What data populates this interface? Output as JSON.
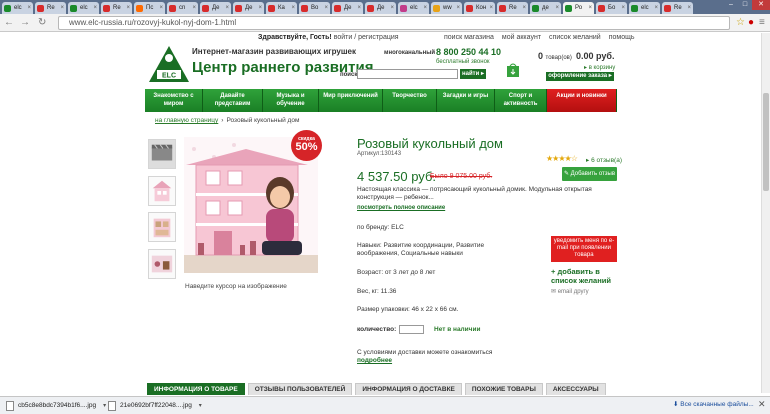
{
  "browser": {
    "tabs": [
      {
        "title": "elc",
        "color": "#1a8a2a"
      },
      {
        "title": "Re",
        "color": "#d72b2b"
      },
      {
        "title": "elc",
        "color": "#1a8a2a"
      },
      {
        "title": "Re",
        "color": "#d72b2b"
      },
      {
        "title": "Пс",
        "color": "#ff6a00"
      },
      {
        "title": "cn",
        "color": "#d72b2b"
      },
      {
        "title": "Де",
        "color": "#d72b2b"
      },
      {
        "title": "Де",
        "color": "#d72b2b"
      },
      {
        "title": "Ка",
        "color": "#d72b2b"
      },
      {
        "title": "Bo",
        "color": "#d72b2b"
      },
      {
        "title": "Де",
        "color": "#d72b2b"
      },
      {
        "title": "Де",
        "color": "#d72b2b"
      },
      {
        "title": "elc",
        "color": "#c23b8a"
      },
      {
        "title": "ww",
        "color": "#e8a317"
      },
      {
        "title": "Кон",
        "color": "#d72b2b"
      },
      {
        "title": "Re",
        "color": "#d72b2b"
      },
      {
        "title": "де",
        "color": "#1a8a2a"
      },
      {
        "title": "Ро",
        "color": "#1a8a2a",
        "active": true
      },
      {
        "title": "Бо",
        "color": "#d72b2b"
      },
      {
        "title": "elc",
        "color": "#1a8a2a"
      },
      {
        "title": "Re",
        "color": "#d72b2b"
      }
    ],
    "url": "www.elc-russia.ru/rozovyj-kukol-nyj-dom-1.html"
  },
  "header": {
    "greeting": "Здравствуйте, Гость!",
    "login": "войти / регистрация",
    "links": [
      "поиск магазина",
      "мой аккаунт",
      "список желаний",
      "помощь"
    ],
    "tagline": "Интернет-магазин развивающих игрушек",
    "brand": "Центр раннего развития",
    "logo_text": "ELC",
    "phone_label": "многоканальный",
    "phone": "8 800 250 44 10",
    "free_call": "бесплатный звонок",
    "search_label": "поиск",
    "search_button": "найти",
    "cart": {
      "count": "0",
      "count_unit": "товар(ов)",
      "sum": "0.00 руб.",
      "link": "в корзину",
      "order": "оформление заказа"
    }
  },
  "nav": [
    {
      "label": "Знакомство с миром",
      "red": false
    },
    {
      "label": "Давайте представим",
      "red": false
    },
    {
      "label": "Музыка и обучение",
      "red": false
    },
    {
      "label": "Мир приключений",
      "red": false
    },
    {
      "label": "Творчество",
      "red": false
    },
    {
      "label": "Загадки и игры",
      "red": false
    },
    {
      "label": "Спорт и активность",
      "red": false
    },
    {
      "label": "Акции и новинки",
      "red": true
    }
  ],
  "breadcrumb": {
    "home": "на главную страницу",
    "current": "Розовый кукольный дом"
  },
  "product": {
    "sale_label": "скидка",
    "sale_pct": "50%",
    "hover_hint": "Наведите курсор на изображение",
    "title": "Розовый кукольный дом",
    "sku": "Артикул:130143",
    "rating": 4,
    "reviews": "6 отзыв(а)",
    "price": "4 537.50 руб.",
    "old_price_label": "Было",
    "old_price": "9 075.00 руб.",
    "add_review": "Добавить отзыв",
    "description": "Настоящая классика — потрясающий кукольный домик. Модульная открытая конструкция — ребенок...",
    "more": "посмотреть полное описание",
    "brand": "по бренду:  ELC",
    "skills": "Навыки:  Развитие координации, Развитие воображения, Социальные навыки",
    "age": "Возраст:  от 3 лет до 8 лет",
    "weight": "Вес, кг:  11.36",
    "size": "Размер упаковки:  46 x 22 x 66 см.",
    "notify": "уведомить меня по e-mail при появлении товара",
    "wishlist": "добавить в список желаний",
    "email_friend": "email другу",
    "qty_label": "количество:",
    "stock": "Нет в наличии",
    "ship_text": "С условиями доставки можете ознакомиться",
    "ship_link": "подробнее"
  },
  "tabs": [
    {
      "label": "ИНФОРМАЦИЯ О ТОВАРЕ",
      "active": true
    },
    {
      "label": "ОТЗЫВЫ ПОЛЬЗОВАТЕЛЕЙ",
      "active": false
    },
    {
      "label": "ИНФОРМАЦИЯ О ДОСТАВКЕ",
      "active": false
    },
    {
      "label": "ПОХОЖИЕ ТОВАРЫ",
      "active": false
    },
    {
      "label": "АКСЕССУАРЫ",
      "active": false
    }
  ],
  "downloads": {
    "items": [
      "cb5c8e8bdc7394b1f6....jpg",
      "21e0692bf7ff22048....jpg"
    ],
    "all": "Все скачанные файлы..."
  },
  "colors": {
    "brand_green": "#1a6e24",
    "sale_red": "#d62428"
  }
}
